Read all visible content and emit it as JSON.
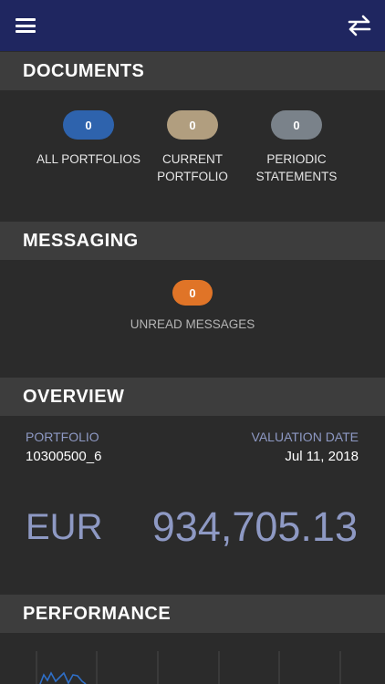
{
  "header": {
    "menu_icon": "hamburger-icon",
    "swap_icon": "swap-arrows-icon",
    "background": "#1f2660"
  },
  "documents": {
    "title": "DOCUMENTS",
    "items": [
      {
        "label": "ALL PORTFOLIOS",
        "count": "0",
        "color": "#2e63ad"
      },
      {
        "label": "CURRENT\nPORTFOLIO",
        "count": "0",
        "color": "#b19e7f"
      },
      {
        "label": "PERIODIC\nSTATEMENTS",
        "count": "0",
        "color": "#7a828a"
      }
    ]
  },
  "messaging": {
    "title": "MESSAGING",
    "unread_count": "0",
    "unread_label": "UNREAD MESSAGES",
    "color": "#e07427"
  },
  "overview": {
    "title": "OVERVIEW",
    "portfolio_label": "PORTFOLIO",
    "portfolio_value": "10300500_6",
    "valuation_label": "VALUATION DATE",
    "valuation_value": "Jul 11, 2018",
    "currency": "EUR",
    "amount": "934,705.13"
  },
  "performance": {
    "title": "PERFORMANCE",
    "line_color": "#2f6fc7"
  }
}
